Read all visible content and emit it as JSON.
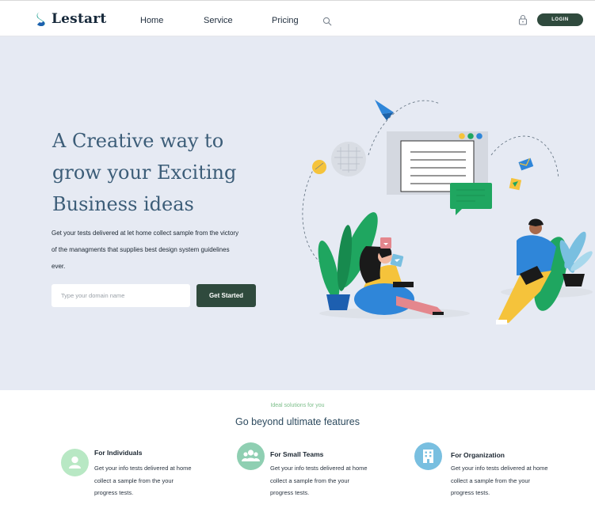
{
  "header": {
    "brand": "Lestart",
    "nav": [
      {
        "label": "Home",
        "icon": null
      },
      {
        "label": "Service",
        "icon": null
      },
      {
        "label": "Pricing",
        "icon": null
      }
    ],
    "search_icon": "search-icon",
    "lock_icon": "lock-icon",
    "login_label": "LOGIN"
  },
  "hero": {
    "title_lines": [
      "A Creative way to",
      "grow your Exciting",
      "Business ideas"
    ],
    "description": "Get your tests delivered at let home collect sample from the victory of the managments that supplies best design system guidelines ever.",
    "input_placeholder": "Type your domain name",
    "cta_label": "Get Started"
  },
  "features": {
    "eyebrow": "Ideal solutions for you",
    "title": "Go beyond ultimate features",
    "items": [
      {
        "name": "For Individuals",
        "description": "Get your info tests delivered at home collect a sample from the your progress tests.",
        "icon": "user-icon",
        "color": "#b8e8c4"
      },
      {
        "name": "For Small Teams",
        "description": "Get your info tests delivered at home collect a sample from the your progress tests.",
        "icon": "team-icon",
        "color": "#8fcfb2"
      },
      {
        "name": "For Organization",
        "description": "Get your info tests delivered at home collect a sample from the your progress tests.",
        "icon": "building-icon",
        "color": "#79bfe0"
      }
    ]
  },
  "colors": {
    "primary": "#2f4a3d",
    "hero_bg": "#e6eaf3",
    "heading": "#3c5d78",
    "accent_green": "#7cbe8a"
  }
}
